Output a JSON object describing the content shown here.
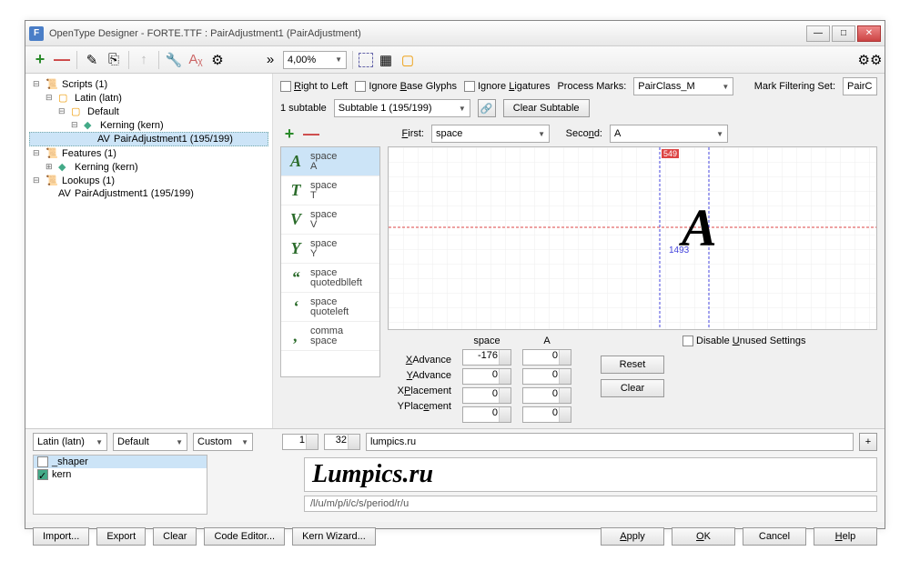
{
  "window": {
    "title": "OpenType Designer - FORTE.TTF : PairAdjustment1 (PairAdjustment)"
  },
  "toolbar": {
    "zoom": "4,00%"
  },
  "tree": {
    "scripts": "Scripts (1)",
    "latin": "Latin (latn)",
    "default": "Default",
    "kerning": "Kerning (kern)",
    "pair_adj": "PairAdjustment1 (195/199)",
    "features": "Features (1)",
    "kern_feat": "Kerning (kern)",
    "lookups": "Lookups (1)",
    "pair_lk": "PairAdjustment1 (195/199)"
  },
  "options": {
    "rtl": "Right to Left",
    "ignore_base": "Ignore Base Glyphs",
    "ignore_lig": "Ignore Ligatures",
    "process_marks": "Process Marks:",
    "pairclass": "PairClass_M",
    "mark_filter": "Mark Filtering Set:",
    "mark_value": "PairC"
  },
  "subtable": {
    "count": "1 subtable",
    "name": "Subtable 1 (195/199)",
    "clear": "Clear Subtable"
  },
  "pair": {
    "first_label": "First:",
    "first_value": "space",
    "second_label": "Second:",
    "second_value": "A"
  },
  "pairs": [
    {
      "glyph": "A",
      "a": "space",
      "b": "A"
    },
    {
      "glyph": "T",
      "a": "space",
      "b": "T"
    },
    {
      "glyph": "V",
      "a": "space",
      "b": "V"
    },
    {
      "glyph": "Y",
      "a": "space",
      "b": "Y"
    },
    {
      "glyph": "“",
      "a": "space",
      "b": "quotedblleft"
    },
    {
      "glyph": "‘",
      "a": "space",
      "b": "quoteleft"
    },
    {
      "glyph": ",",
      "a": "comma",
      "b": "space"
    }
  ],
  "metrics": {
    "header_first": "space",
    "header_second": "A",
    "xadv": "XAdvance",
    "xadv_v1": "-176",
    "xadv_v2": "0",
    "yadv": "YAdvance",
    "yadv_v1": "0",
    "yadv_v2": "0",
    "xpl": "XPlacement",
    "xpl_v1": "0",
    "xpl_v2": "0",
    "ypl": "YPlacement",
    "ypl_v1": "0",
    "ypl_v2": "0",
    "reset": "Reset",
    "clear": "Clear",
    "disable": "Disable Unused Settings",
    "num1": "549",
    "num2": "1493"
  },
  "bottom": {
    "script_sel": "Latin (latn)",
    "lang_sel": "Default",
    "mode_sel": "Custom",
    "sp1": "1",
    "sp2": "32",
    "sample": "lumpics.ru",
    "preview": "Lumpics.ru",
    "decomp": "/l/u/m/p/i/c/s/period/r/u",
    "shaper": "_shaper",
    "kern": "kern"
  },
  "buttons": {
    "import": "Import...",
    "export": "Export",
    "clear": "Clear",
    "code_editor": "Code Editor...",
    "kern_wizard": "Kern Wizard...",
    "apply": "Apply",
    "ok": "OK",
    "cancel": "Cancel",
    "help": "Help"
  }
}
